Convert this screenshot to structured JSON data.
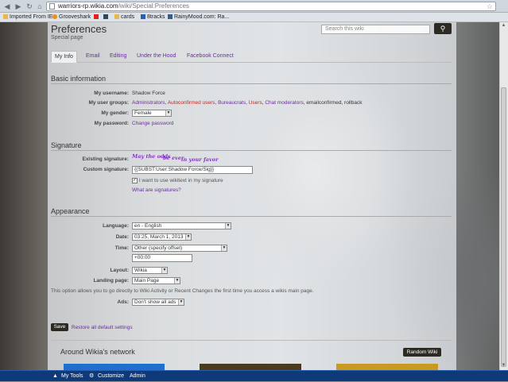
{
  "browser": {
    "url_domain": "warriors-rp.wikia.com",
    "url_path": "/wiki/Special:Preferences",
    "bookmarks": [
      "Imported From IE",
      "Grooveshark",
      "cards",
      "8tracks",
      "RainyMood.com: Ra..."
    ]
  },
  "header": {
    "title": "Preferences",
    "subtitle": "Special page",
    "search_placeholder": "Search this wiki"
  },
  "tabs": [
    "My Info",
    "Email",
    "Editing",
    "Under the Hood",
    "Facebook Connect"
  ],
  "basic": {
    "heading": "Basic information",
    "username_label": "My username:",
    "username": "Shadow Force",
    "groups_label": "My user groups:",
    "groups": {
      "g1": "Administrators",
      "g2": "Autoconfirmed users",
      "g3": "Bureaucrats",
      "g4": "Users",
      "g5": "Chat moderators",
      "rest": ", emailconfirmed, rollback"
    },
    "gender_label": "My gender:",
    "gender": "Female",
    "password_label": "My password:",
    "password_link": "Change password"
  },
  "signature": {
    "heading": "Signature",
    "existing_label": "Existing signature:",
    "existing": {
      "a": "May the odds",
      "b": "be ever",
      "c": "in your favor"
    },
    "custom_label": "Custom signature:",
    "custom_value": "{{SUBST:User:Shadow Force/Sig}}",
    "wikitext_label": "I want to use wikitext in my signature",
    "help_link": "What are signatures?"
  },
  "appearance": {
    "heading": "Appearance",
    "language_label": "Language:",
    "language": "en - English",
    "date_label": "Date:",
    "date": "03:25, March 1, 2013",
    "time_label": "Time:",
    "time": "Other (specify offset)",
    "offset": "+00:00",
    "layout_label": "Layout:",
    "layout": "Wikia",
    "landing_label": "Landing page:",
    "landing": "Main Page",
    "landing_note": "This option allows you to go directly to Wiki Activity or Recent Changes the first time you access a wikis main page.",
    "ads_label": "Ads:",
    "ads": "Don't show all ads"
  },
  "actions": {
    "save": "Save",
    "restore": "Restore all default settings"
  },
  "network": {
    "title": "Around Wikia's network",
    "random_button": "Random Wiki"
  },
  "toolbar": {
    "my_tools": "My Tools",
    "customize": "Customize",
    "admin": "Admin"
  },
  "colors": {
    "link": "#6a2e9a",
    "accent_button": "#2c2a22",
    "toolbar": "#0f3a7a"
  }
}
